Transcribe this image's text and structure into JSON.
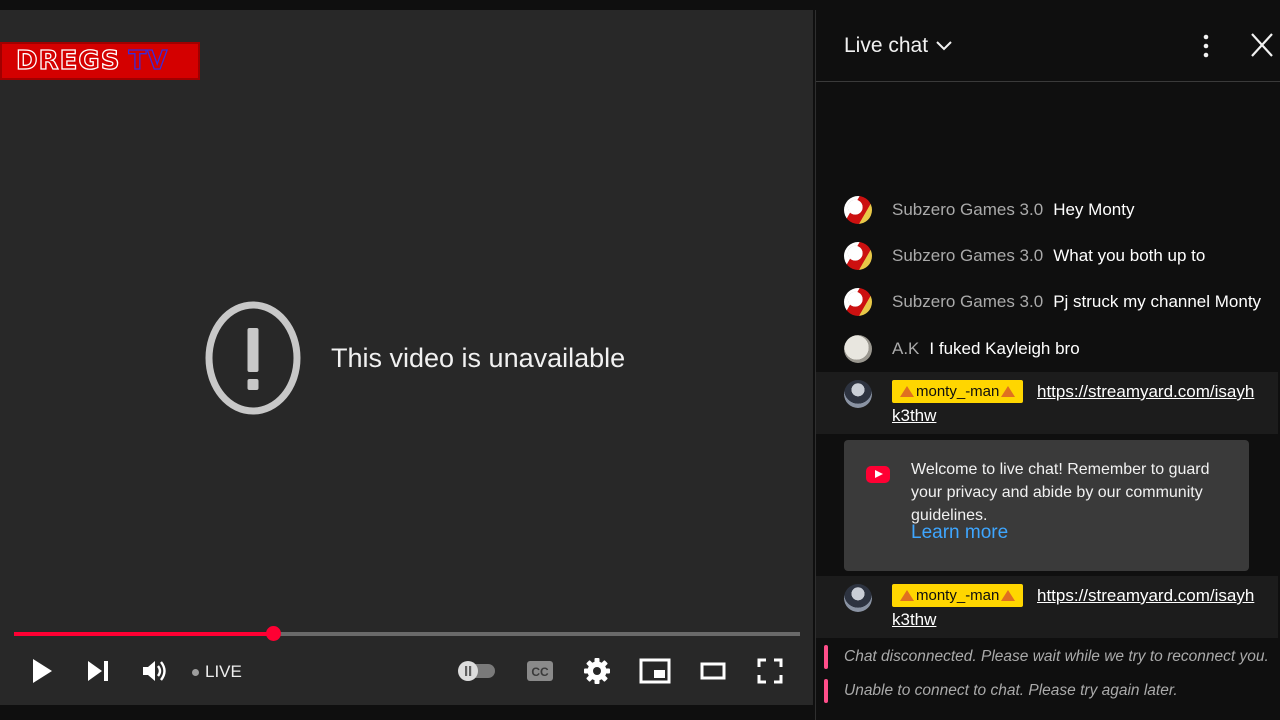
{
  "player": {
    "logo_main": "DREGS",
    "logo_suffix": "TV",
    "error_message": "This video is unavailable",
    "live_label": "LIVE",
    "progress_fraction": 0.33,
    "controls": [
      "play-icon",
      "next-icon",
      "volume-icon",
      "autoplay-toggle-icon",
      "captions-icon",
      "settings-icon",
      "miniplayer-icon",
      "theater-mode-icon",
      "fullscreen-icon"
    ],
    "captions_label": "CC"
  },
  "chat": {
    "title": "Live chat",
    "messages": [
      {
        "author": "Subzero Games 3.0",
        "text": "Hey Monty"
      },
      {
        "author": "Subzero Games 3.0",
        "text": "What you both up to"
      },
      {
        "author": "Subzero Games 3.0",
        "text": "Pj struck my channel Monty"
      },
      {
        "author": "A.K",
        "text": "I fuked Kayleigh bro"
      }
    ],
    "owner_messages": [
      {
        "author": "monty_-man",
        "link_line1": "https://streamyard.com/isayh",
        "link_line2": "k3thw"
      },
      {
        "author": "monty_-man",
        "link_line1": "https://streamyard.com/isayh",
        "link_line2": "k3thw"
      }
    ],
    "welcome": {
      "text": "Welcome to live chat! Remember to guard your privacy and abide by our community guidelines.",
      "learn_more": "Learn more"
    },
    "system_messages": [
      "Chat disconnected. Please wait while we try to reconnect you.",
      "Unable to connect to chat. Please try again later."
    ]
  },
  "colors": {
    "accent_red": "#ff0033",
    "owner_badge": "#ffd600",
    "link_blue": "#3ea6ff",
    "system_bar": "#ff4e8a"
  }
}
